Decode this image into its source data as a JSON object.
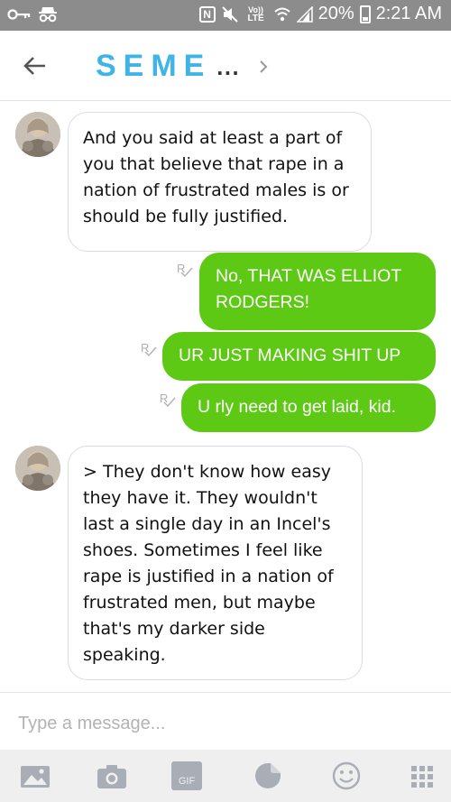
{
  "status_bar": {
    "network": "LTE",
    "battery": "20%",
    "time": "2:21 AM"
  },
  "header": {
    "title": "SEME",
    "title_ellipsis": "...",
    "accent_color": "#3fb4e8"
  },
  "messages": [
    {
      "direction": "incoming",
      "text": "And you said at least a part of you that believe that rape in a nation of frustrated males is or should be fully justified."
    },
    {
      "direction": "outgoing",
      "read_mark": "R",
      "lines": [
        "No, THAT WAS ELLIOT",
        "RODGERS!"
      ]
    },
    {
      "direction": "outgoing",
      "read_mark": "R",
      "lines": [
        "UR JUST MAKING SHIT UP"
      ]
    },
    {
      "direction": "outgoing",
      "read_mark": "R",
      "lines": [
        "U rly need to get laid, kid."
      ]
    },
    {
      "direction": "incoming",
      "text": "> They don't know how easy they have it. They wouldn't last a single day in an Incel's shoes. Sometimes I feel like rape is justified in a nation of frustrated men, but maybe that's my darker side speaking."
    }
  ],
  "composer": {
    "placeholder": "Type a message..."
  },
  "toolbar": {
    "items": [
      "image-icon",
      "camera-icon",
      "gif-icon",
      "sticker-icon",
      "emoji-icon",
      "apps-grid-icon"
    ],
    "gif_label": "GIF",
    "icon_color": "#a9adb6"
  },
  "colors": {
    "outgoing_bubble": "#5dc914",
    "status_bar": "#8c8c8c"
  }
}
